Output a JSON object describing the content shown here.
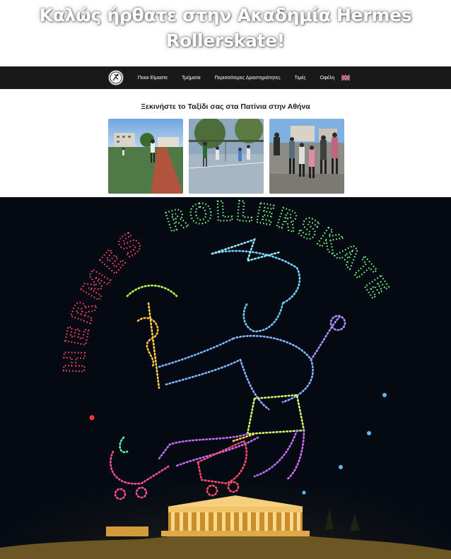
{
  "hero": {
    "title_line1": "Καλώς ήρθατε στην Ακαδημία Hermes",
    "title_line2": "Rollerskate!"
  },
  "nav": {
    "logo_icon": "hermes-logo-icon",
    "items": [
      {
        "label": "Ποιοι Είμαστε"
      },
      {
        "label": "Τμήματα"
      },
      {
        "label": "Περισσότερες Δραστηριότητες"
      },
      {
        "label": "Τιμές"
      },
      {
        "label": "Οφέλη"
      }
    ],
    "language_icon": "uk-flag-icon"
  },
  "intro": {
    "heading": "Ξεκινήστε το Ταξίδι σας στα Πατίνια στην Αθήνα"
  },
  "banner": {
    "arc_text_left": "HERMES",
    "arc_text_right": "ROLLERSKATE"
  },
  "colors": {
    "navbar_bg": "#191919",
    "banner_bg": "#040912",
    "heading_text": "#1e1e1e"
  }
}
